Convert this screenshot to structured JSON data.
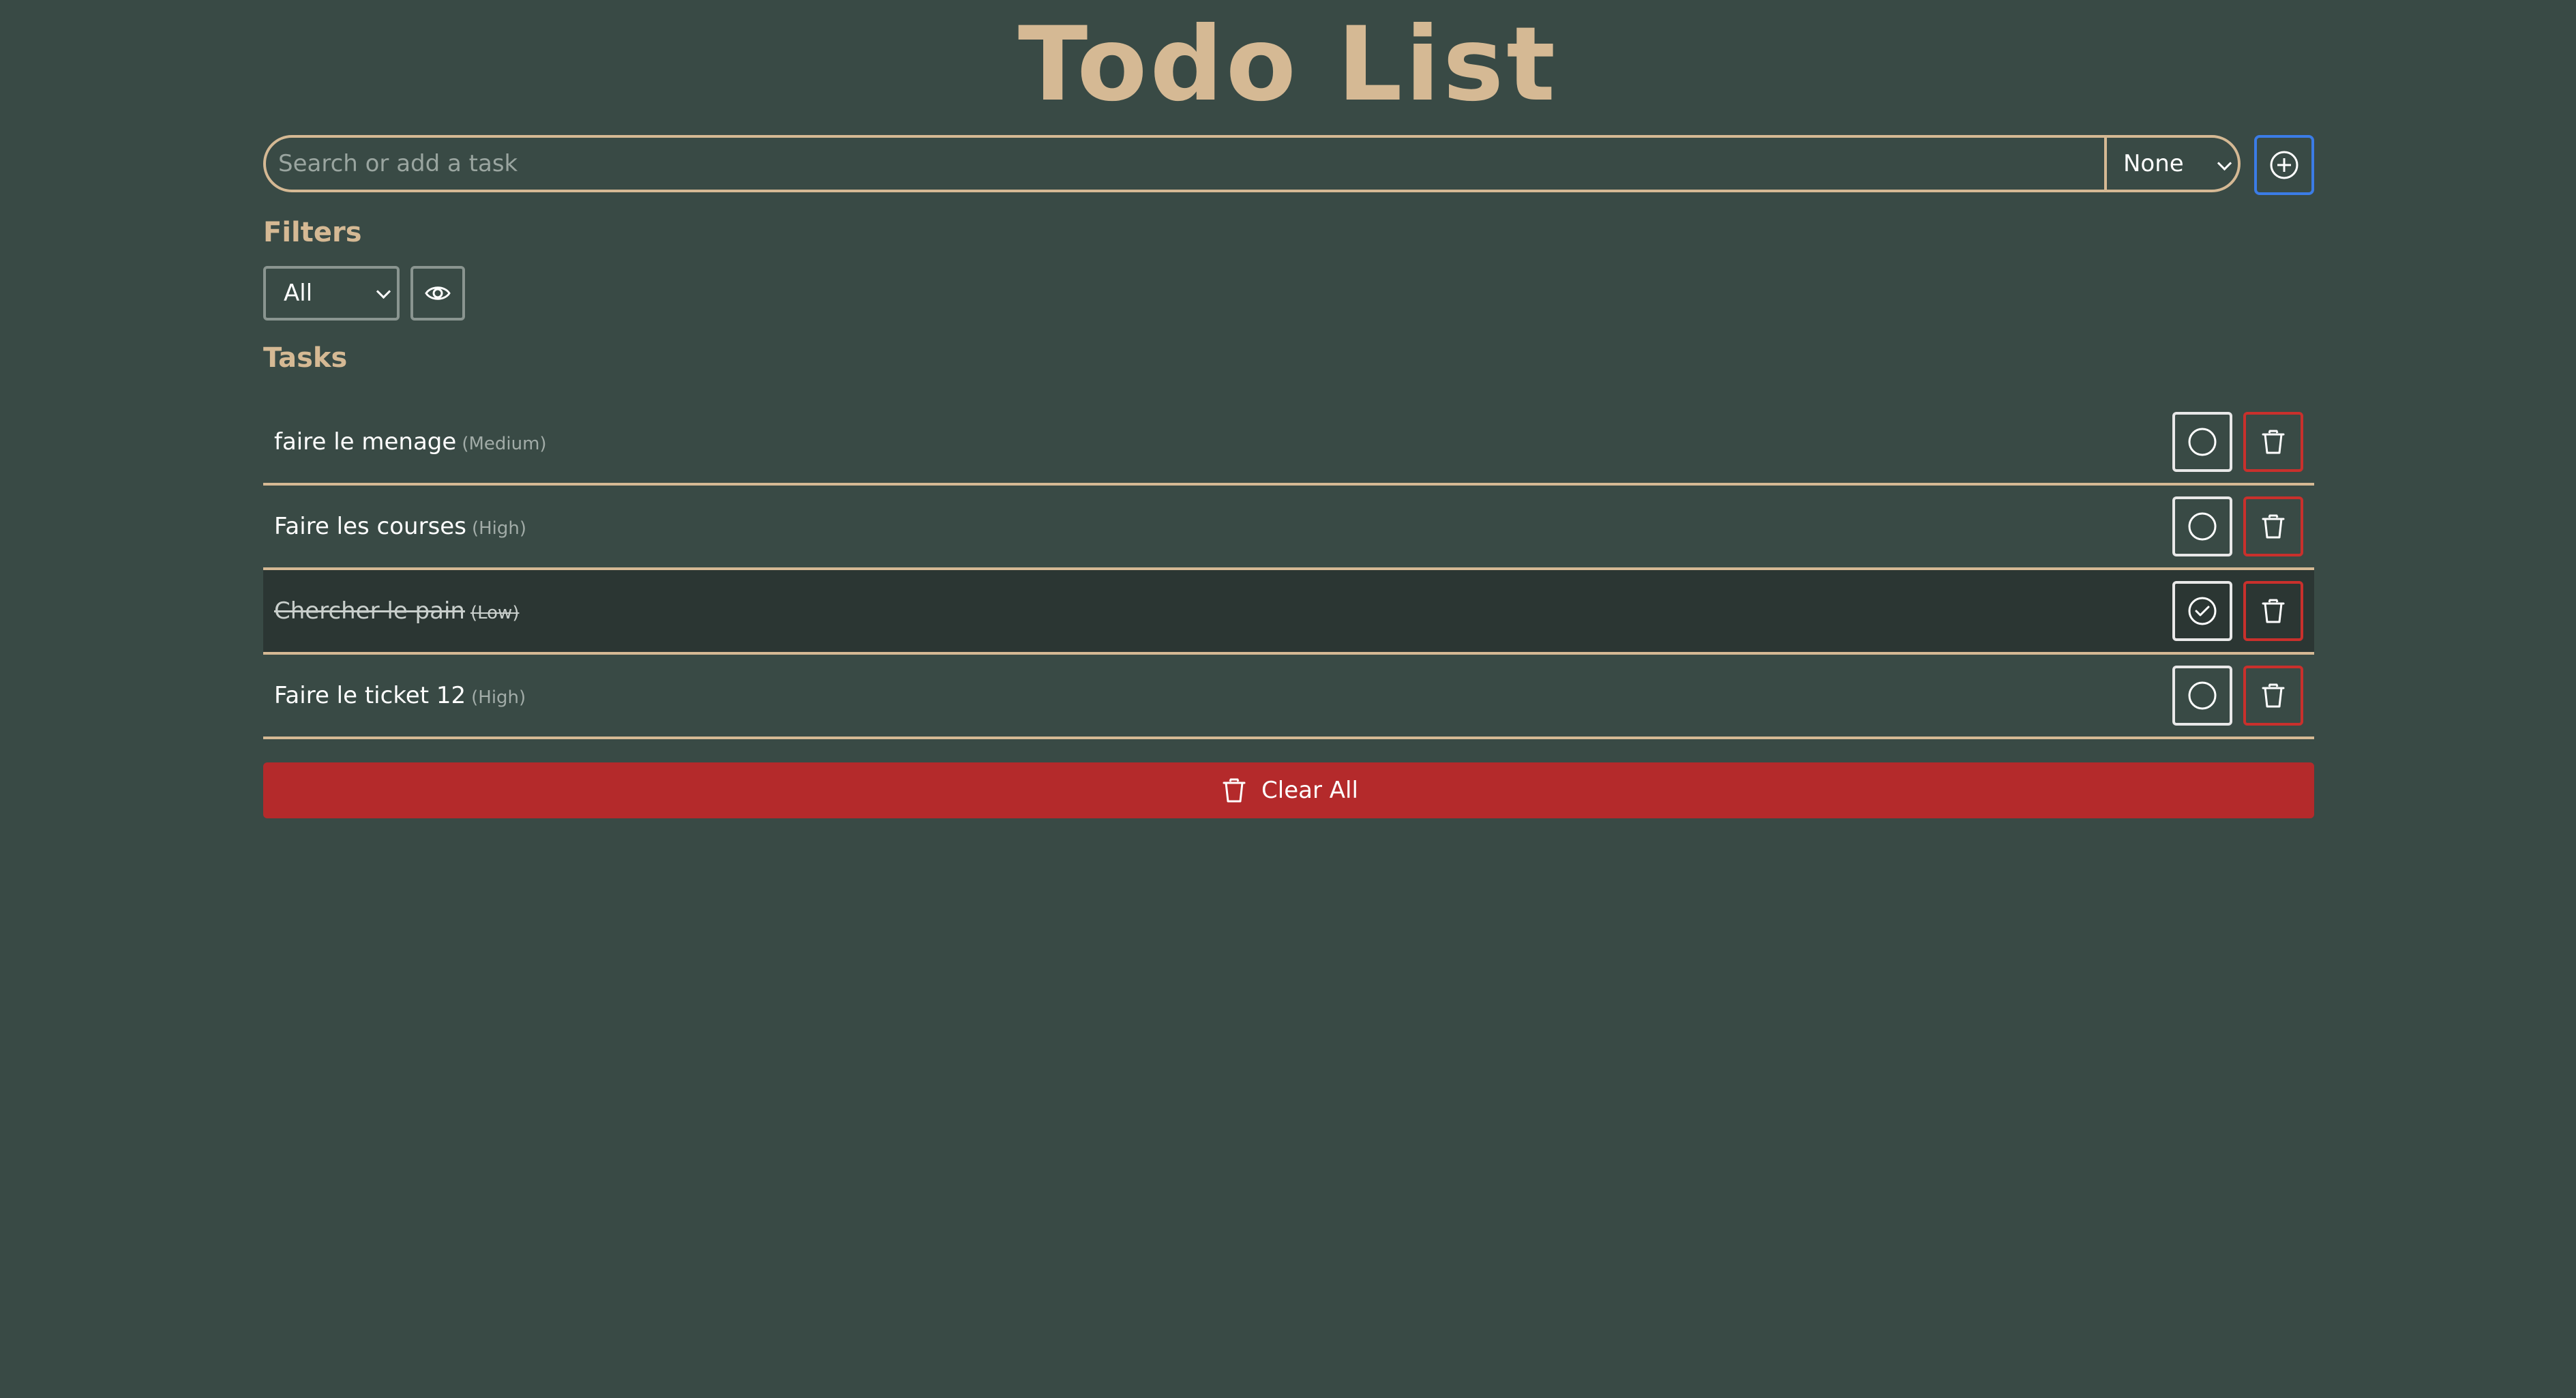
{
  "header": {
    "title": "Todo List"
  },
  "search": {
    "placeholder": "Search or add a task",
    "value": "",
    "priority_selected": "None",
    "add_icon": "plus-circle-icon"
  },
  "filters": {
    "heading": "Filters",
    "selected": "All",
    "visibility_icon": "eye-icon"
  },
  "tasks": {
    "heading": "Tasks",
    "items": [
      {
        "name": "faire le menage",
        "priority": "(Medium)",
        "completed": false
      },
      {
        "name": "Faire les courses",
        "priority": "(High)",
        "completed": false
      },
      {
        "name": "Chercher le pain",
        "priority": "(Low)",
        "completed": true
      },
      {
        "name": "Faire le ticket 12",
        "priority": "(High)",
        "completed": false
      }
    ]
  },
  "clear_all": {
    "label": "Clear All",
    "icon": "trash-icon"
  },
  "colors": {
    "background": "#394a45",
    "accent": "#d5b994",
    "primary_button_border": "#3b7ce6",
    "danger": "#b42a2b",
    "completed_row": "#2b3633"
  }
}
